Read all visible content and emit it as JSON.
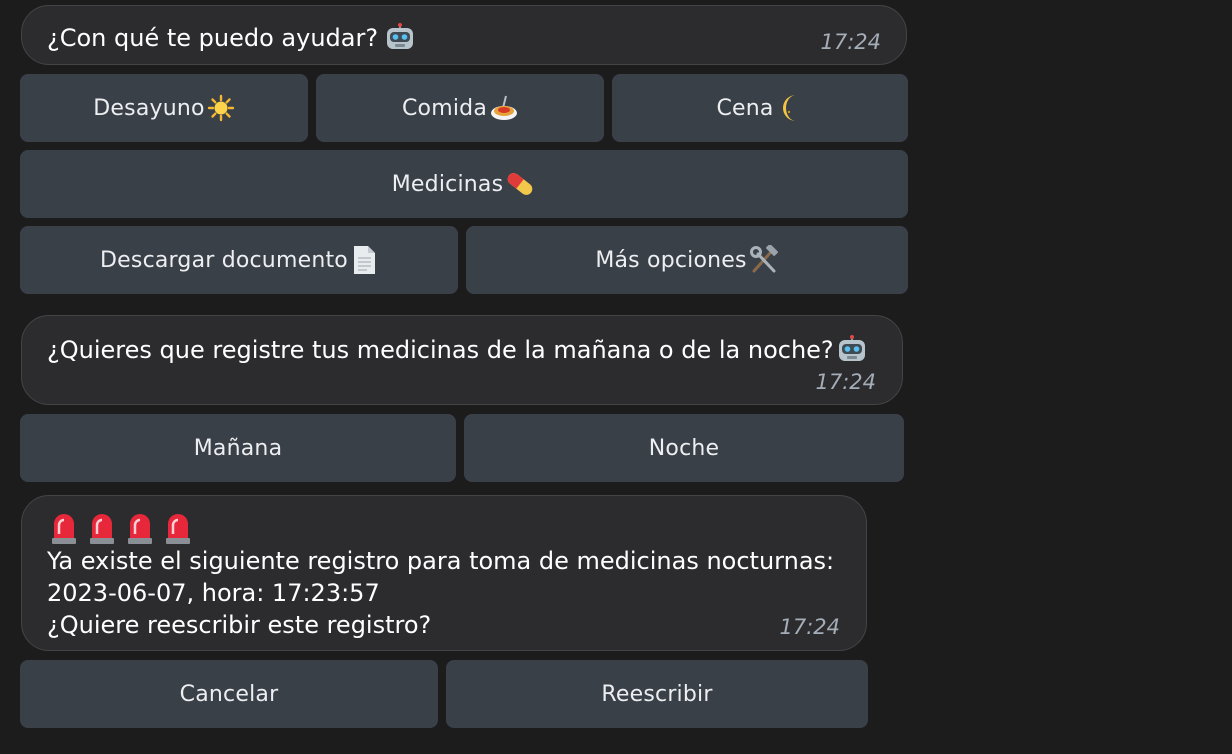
{
  "messages": [
    {
      "text": "¿Con qué te puedo ayudar?",
      "emoji": "robot-icon",
      "time": "17:24",
      "buttons": [
        [
          "Desayuno",
          "Comida",
          "Cena"
        ],
        [
          "Medicinas"
        ],
        [
          "Descargar documento",
          "Más opciones"
        ]
      ],
      "button_icons": [
        [
          "sun-icon",
          "spaghetti-icon",
          "crescent-moon-icon"
        ],
        [
          "pill-icon"
        ],
        [
          "page-icon",
          "hammer-wrench-icon"
        ]
      ]
    },
    {
      "text": "¿Quieres que registre tus medicinas de la mañana o de la noche?",
      "emoji": "robot-icon",
      "time": "17:24",
      "buttons": [
        [
          "Mañana",
          "Noche"
        ]
      ]
    },
    {
      "sirens": 4,
      "line1": "Ya existe el siguiente registro para toma de medicinas nocturnas:",
      "line2": "2023-06-07, hora: 17:23:57",
      "line3": "¿Quiere reescribir este registro?",
      "time": "17:24",
      "buttons": [
        [
          "Cancelar",
          "Reescribir"
        ]
      ]
    }
  ],
  "colors": {
    "background": "#1c1c1d",
    "bubble": "#2c2c2e",
    "button": "#3a4048",
    "timestamp": "#a4adb8"
  }
}
